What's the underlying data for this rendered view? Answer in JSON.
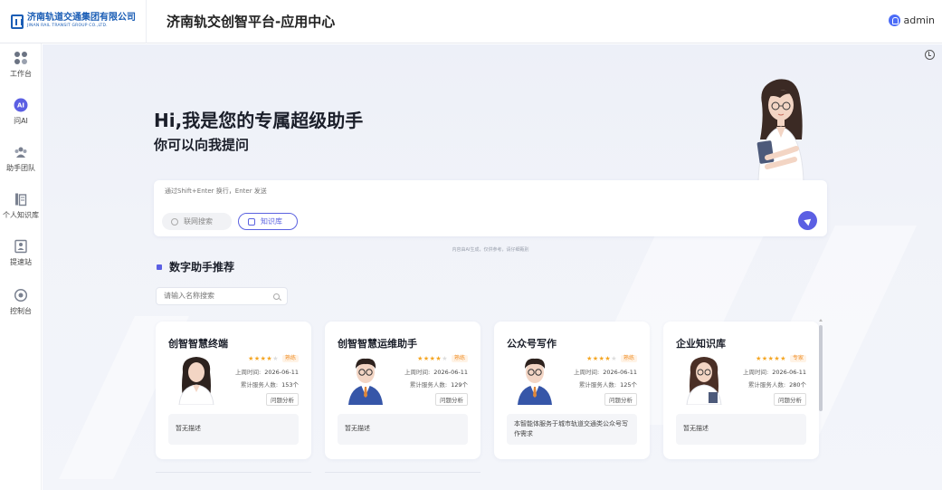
{
  "header": {
    "logo_cn": "济南轨道交通集团有限公司",
    "logo_en": "JINAN RAIL TRANSIT GROUP CO.,LTD.",
    "title": "济南轨交创智平台-应用中心",
    "user": "admin"
  },
  "sidebar": {
    "items": [
      {
        "label": "工作台",
        "icon": "grid-icon"
      },
      {
        "label": "问AI",
        "icon": "ai-icon"
      },
      {
        "label": "助手团队",
        "icon": "team-icon"
      },
      {
        "label": "个人知识库",
        "icon": "library-icon"
      },
      {
        "label": "提速站",
        "icon": "station-icon"
      },
      {
        "label": "控制台",
        "icon": "console-icon"
      }
    ]
  },
  "hero": {
    "title": "Hi,我是您的专属超级助手",
    "subtitle": "你可以向我提问"
  },
  "chat": {
    "placeholder": "通过Shift+Enter 换行，Enter 发送",
    "web_search": "联网搜索",
    "knowledge_base": "知识库",
    "disclaimer": "内容由AI生成，仅供参考，请仔细甄别"
  },
  "section": {
    "title": "数字助手推荐",
    "search_placeholder": "请输入名称搜索"
  },
  "labels": {
    "last_time": "上周时间:",
    "served": "累计服务人数:",
    "tag": "问题分析"
  },
  "cards": [
    {
      "title": "创智智慧终端",
      "rating": 4,
      "level": "熟练",
      "date": "2026-06-11",
      "served": "153个",
      "tag": "问题分析",
      "desc": "暂无描述",
      "avatar": "female-avatar"
    },
    {
      "title": "创智智慧运维助手",
      "rating": 4,
      "level": "熟练",
      "date": "2026-06-11",
      "served": "129个",
      "tag": "问题分析",
      "desc": "暂无描述",
      "avatar": "male-avatar"
    },
    {
      "title": "公众号写作",
      "rating": 4,
      "level": "熟练",
      "date": "2026-06-11",
      "served": "125个",
      "tag": "问题分析",
      "desc": "本智能体服务于城市轨道交通类公众号写作需求",
      "avatar": "male-avatar"
    },
    {
      "title": "企业知识库",
      "rating": 5,
      "level": "专家",
      "date": "2026-06-11",
      "served": "280个",
      "tag": "问题分析",
      "desc": "暂无描述",
      "avatar": "female-avatar"
    }
  ],
  "colors": {
    "accent": "#5b5fe3",
    "brand": "#1a5db5",
    "star": "#f5a623"
  }
}
